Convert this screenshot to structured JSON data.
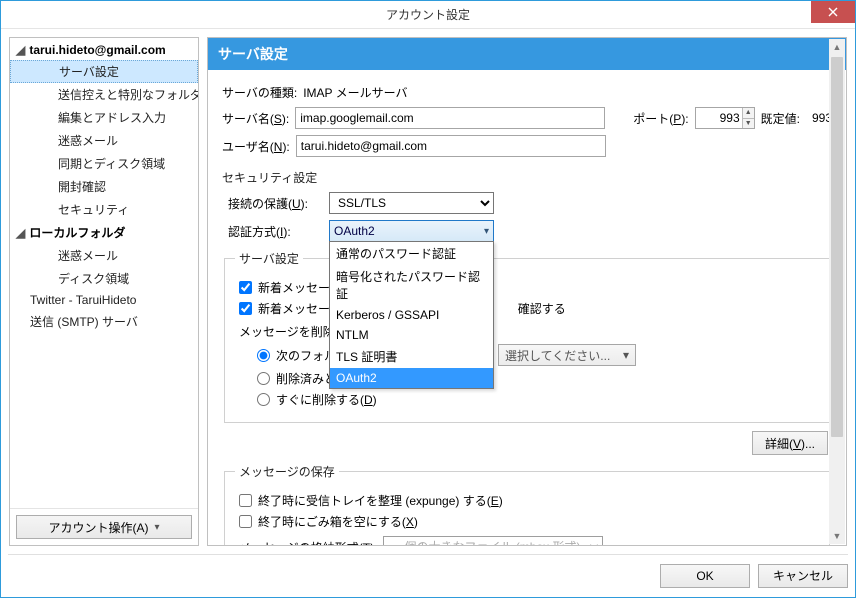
{
  "window": {
    "title": "アカウント設定"
  },
  "sidebar": {
    "account_top": "tarui.hideto@gmail.com",
    "items": [
      "サーバ設定",
      "送信控えと特別なフォルダ",
      "編集とアドレス入力",
      "迷惑メール",
      "同期とディスク領域",
      "開封確認",
      "セキュリティ"
    ],
    "local_top": "ローカルフォルダ",
    "local_items": [
      "迷惑メール",
      "ディスク領域"
    ],
    "twitter": "Twitter - TaruiHideto",
    "smtp": "送信 (SMTP) サーバ",
    "acct_ops": "アカウント操作(A)"
  },
  "main": {
    "header": "サーバ設定",
    "server_type_label": "サーバの種類:",
    "server_type_value": "IMAP メールサーバ",
    "server_name_label_pre": "サーバ名(",
    "server_name_key": "S",
    "server_name_label_post": "):",
    "server_name_value": "imap.googlemail.com",
    "port_label_pre": "ポート(",
    "port_key": "P",
    "port_label_post": "):",
    "port_value": "993",
    "default_label": "既定値:",
    "default_value": "993",
    "user_label_pre": "ユーザ名(",
    "user_key": "N",
    "user_label_post": "):",
    "user_value": "tarui.hideto@gmail.com",
    "security_header": "セキュリティ設定",
    "conn_sec_label_pre": "接続の保護(",
    "conn_sec_key": "U",
    "conn_sec_label_post": "):",
    "conn_sec_value": "SSL/TLS",
    "auth_label_pre": "認証方式(",
    "auth_key": "I",
    "auth_label_post": "):",
    "auth_value": "OAuth2",
    "auth_options": [
      "通常のパスワード認証",
      "暗号化されたパスワード認証",
      "Kerberos / GSSAPI",
      "NTLM",
      "TLS 証明書",
      "OAuth2"
    ],
    "server_sub_header": "サーバ設定",
    "chk_new1": "新着メッセージ",
    "chk_new2_pre": "新着メッセージ",
    "chk_new2_post": "確認する",
    "delete_label": "メッセージを削除する",
    "radio_folder_pre": "次のフォル",
    "radio_folder_sel": "選択してください...",
    "radio_mark_pre": "削除済みとマークする(",
    "radio_mark_key": "K",
    "radio_mark_post": ")",
    "radio_now_pre": "すぐに削除する(",
    "radio_now_key": "D",
    "radio_now_post": ")",
    "detail_btn_pre": "詳細(",
    "detail_btn_key": "V",
    "detail_btn_post": ")...",
    "storage_header": "メッセージの保存",
    "expunge_pre": "終了時に受信トレイを整理 (expunge) する(",
    "expunge_key": "E",
    "expunge_post": ")",
    "empty_trash_pre": "終了時にごみ箱を空にする(",
    "empty_trash_key": "X",
    "empty_trash_post": ")",
    "store_fmt_label_pre": "メッセージの格納形式(",
    "store_fmt_key": "T",
    "store_fmt_label_post": "):",
    "store_fmt_value": "一個の大きなファイル (mbox 形式)"
  },
  "footer": {
    "ok": "OK",
    "cancel": "キャンセル"
  }
}
